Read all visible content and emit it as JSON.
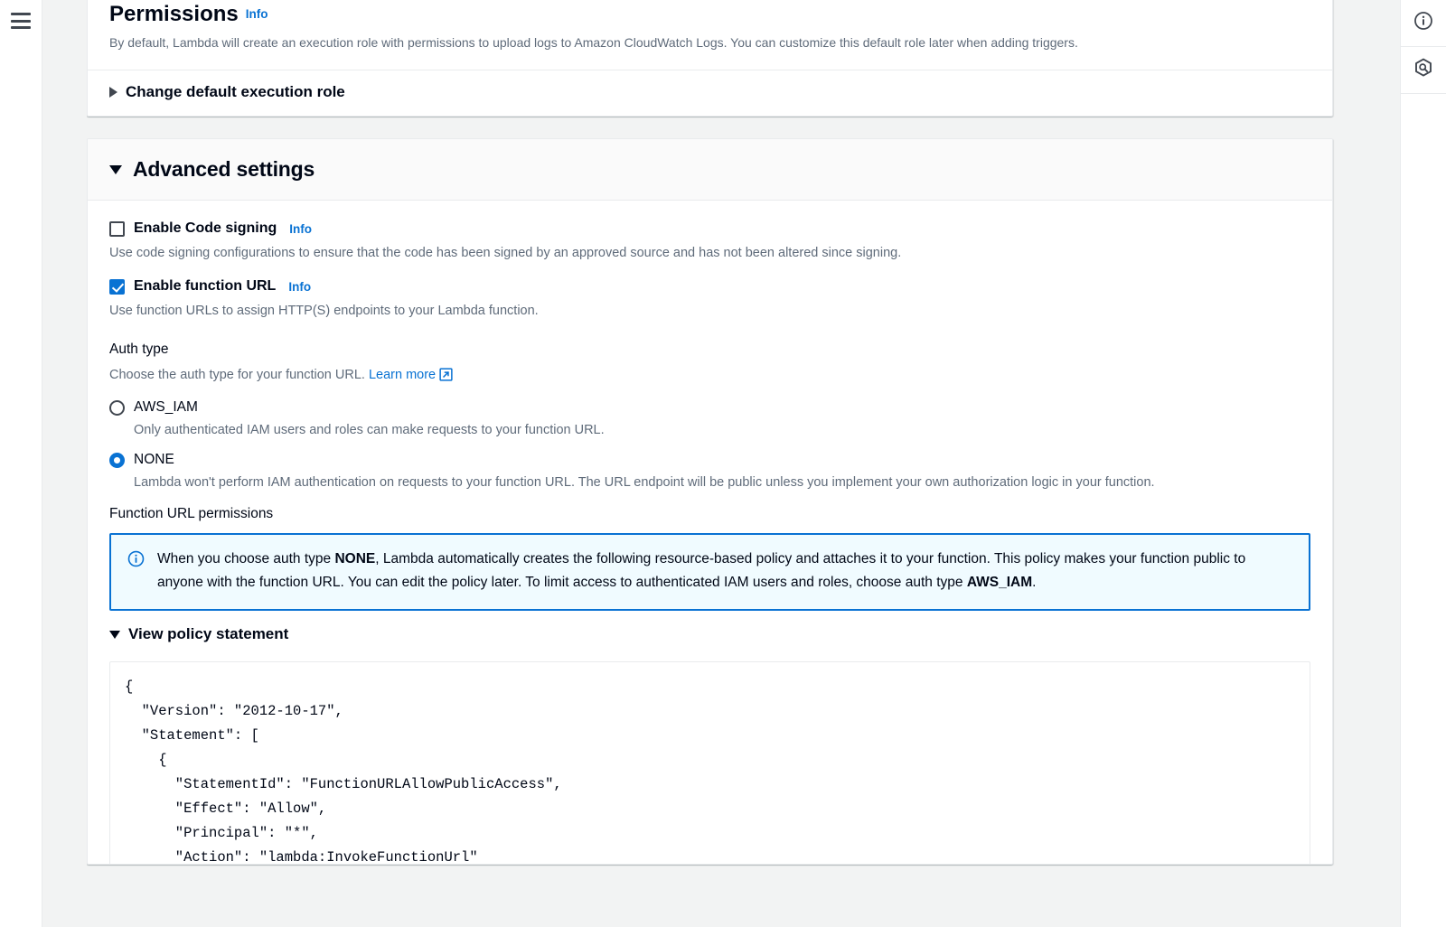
{
  "left_rail": {
    "menu_icon": "hamburger-menu-icon"
  },
  "right_rail": {
    "info_icon": "info-circle-icon",
    "assistant_icon": "aws-q-hexagon-icon"
  },
  "permissions": {
    "title": "Permissions",
    "info_label": "Info",
    "description": "By default, Lambda will create an execution role with permissions to upload logs to Amazon CloudWatch Logs. You can customize this default role later when adding triggers.",
    "change_role_label": "Change default execution role",
    "change_role_expanded": false
  },
  "advanced_settings": {
    "title": "Advanced settings",
    "expanded": true,
    "code_signing": {
      "label": "Enable Code signing",
      "info_label": "Info",
      "checked": false,
      "description": "Use code signing configurations to ensure that the code has been signed by an approved source and has not been altered since signing."
    },
    "function_url": {
      "label": "Enable function URL",
      "info_label": "Info",
      "checked": true,
      "description": "Use function URLs to assign HTTP(S) endpoints to your Lambda function."
    },
    "auth_type": {
      "label": "Auth type",
      "sub_text": "Choose the auth type for your function URL.",
      "learn_more_label": "Learn more",
      "selected": "NONE",
      "options": [
        {
          "value": "AWS_IAM",
          "label": "AWS_IAM",
          "description": "Only authenticated IAM users and roles can make requests to your function URL.",
          "selected": false
        },
        {
          "value": "NONE",
          "label": "NONE",
          "description": "Lambda won't perform IAM authentication on requests to your function URL. The URL endpoint will be public unless you implement your own authorization logic in your function.",
          "selected": true
        }
      ]
    },
    "function_url_permissions": {
      "label": "Function URL permissions",
      "alert": {
        "icon": "info-circle-icon",
        "part1": "When you choose auth type ",
        "bold1": "NONE",
        "part2": ", Lambda automatically creates the following resource-based policy and attaches it to your function. This policy makes your function public to anyone with the function URL. You can edit the policy later. To limit access to authenticated IAM users and roles, choose auth type ",
        "bold2": "AWS_IAM",
        "part3": "."
      },
      "view_policy_label": "View policy statement",
      "view_policy_expanded": true,
      "policy_json": "{\n  \"Version\": \"2012-10-17\",\n  \"Statement\": [\n    {\n      \"StatementId\": \"FunctionURLAllowPublicAccess\",\n      \"Effect\": \"Allow\",\n      \"Principal\": \"*\",\n      \"Action\": \"lambda:InvokeFunctionUrl\""
    }
  },
  "colors": {
    "accent": "#0972d3",
    "text": "#000716",
    "secondary_text": "#5f6b7a",
    "page_bg": "#f2f3f3",
    "alert_bg": "#f0fbff",
    "header_bg": "#fafafa"
  }
}
